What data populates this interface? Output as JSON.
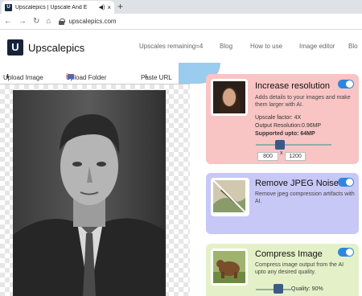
{
  "browser": {
    "tab_title": "Upscalepics | Upscale And E",
    "favicon_letter": "U",
    "sound_glyph": "◀)",
    "close_glyph": "×",
    "new_tab_glyph": "+",
    "back_glyph": "←",
    "forward_glyph": "→",
    "reload_glyph": "↻",
    "home_glyph": "⌂",
    "url": "upscalepics.com"
  },
  "header": {
    "logo_letter": "U",
    "brand": "Upscalepics",
    "nav": [
      "Upscales remaining=4",
      "Blog",
      "How to use",
      "Image editor",
      "Blo"
    ]
  },
  "upload": {
    "image_label": "Upload Image",
    "folder_label": "Upload Folder",
    "pro_badge": "Pro",
    "paste_label": "Paste URL"
  },
  "cards": {
    "increase": {
      "title": "Increase resolution",
      "desc": "Adds details to your images and make them larger with AI.",
      "factor": "Upscale factor: 4X",
      "output": "Output Resolution:0.96MP",
      "supported": "Supported upto: 64MP",
      "width": "800",
      "x": "x",
      "height": "1200",
      "bg": "#f8c4c4",
      "enabled": true
    },
    "jpeg": {
      "title": "Remove JPEG Noise",
      "desc": "Remove jpeg compression artifacts with AI.",
      "bg": "#c8c8f6",
      "enabled": true
    },
    "compress": {
      "title": "Compress Image",
      "desc": "Compress image output from the AI upto any desired quality.",
      "quality": "Quality: 90%",
      "bg": "#e4f1c8",
      "enabled": true
    }
  },
  "colors": {
    "accent": "#2e86de",
    "brand": "#16243b"
  }
}
